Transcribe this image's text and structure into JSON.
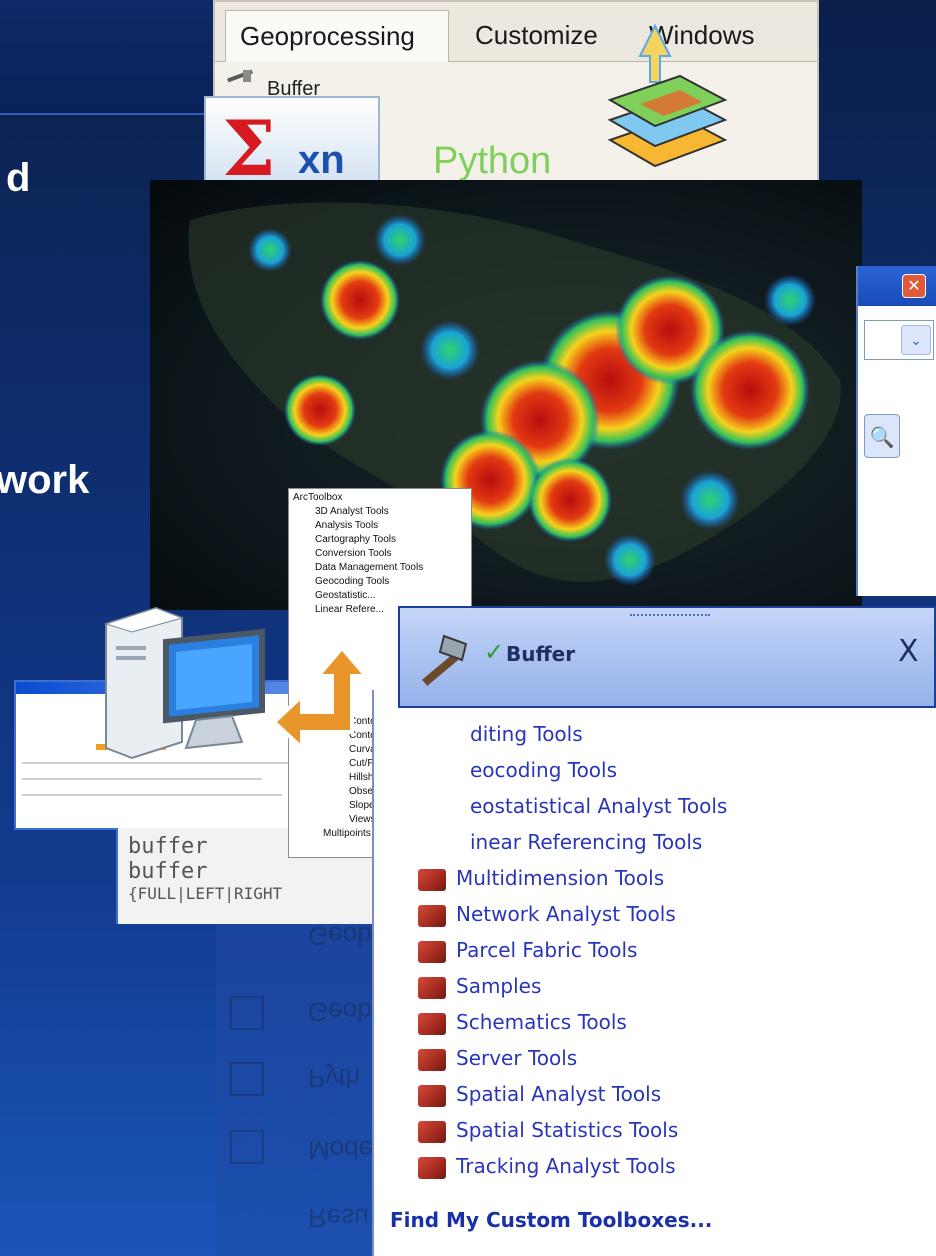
{
  "slide": {
    "partial_word_1": "d",
    "partial_word_2": "work"
  },
  "ribbon": {
    "tabs": [
      "Geoprocessing",
      "Customize",
      "Windows"
    ],
    "first_tool": "Buffer"
  },
  "sigma_tile": {
    "symbol": "Σ",
    "label": "xn"
  },
  "python_label": "Python",
  "toolbox_tree": {
    "items": [
      "ArcToolbox",
      "3D Analyst Tools",
      "Analysis Tools",
      "Cartography Tools",
      "Conversion Tools",
      "Data Management Tools",
      "Geocoding Tools",
      "Geostatistic...",
      "Linear Refere...",
      "Contour",
      "Contour List",
      "Curvature",
      "Cut/Fill",
      "Hillshade",
      "Observer Points",
      "Slope",
      "Viewshed",
      "Multipoints"
    ]
  },
  "code_lines": [
    "buffer",
    "buffer",
    "{FULL|LEFT|RIGHT"
  ],
  "catalog": {
    "close_glyph": "✕",
    "dropdown_glyph": "⌄",
    "search_glyph": "🔍"
  },
  "search_window": {
    "items": [
      "Geob",
      "Geob",
      "Pyth",
      "Mode",
      "Resu"
    ]
  },
  "banner": {
    "check_glyph": "✓",
    "tool_name": "Buffer",
    "close_glyph": "X"
  },
  "tool_list": {
    "partial_items": [
      "diting Tools",
      "eocoding Tools",
      "eostatistical Analyst Tools",
      "inear Referencing Tools"
    ],
    "items": [
      "Multidimension Tools",
      "Network Analyst Tools",
      "Parcel Fabric Tools",
      "Samples",
      "Schematics Tools",
      "Server Tools",
      "Spatial Analyst Tools",
      "Spatial Statistics Tools",
      "Tracking Analyst Tools"
    ],
    "find_link": "Find My Custom Toolboxes..."
  },
  "colors": {
    "slide_bg": "#0e2d6e",
    "tool_text": "#2a36b8",
    "banner_bg": "#a9c1f0",
    "python_green": "#7fd05a",
    "sigma_red": "#d71920",
    "arrow_orange": "#e8962a"
  },
  "icons": [
    "hammer-icon",
    "sigma-icon",
    "layers-icon",
    "up-arrow-icon",
    "computer-icon",
    "bent-arrow-icon",
    "toolbox-icon",
    "check-icon",
    "close-icon"
  ]
}
